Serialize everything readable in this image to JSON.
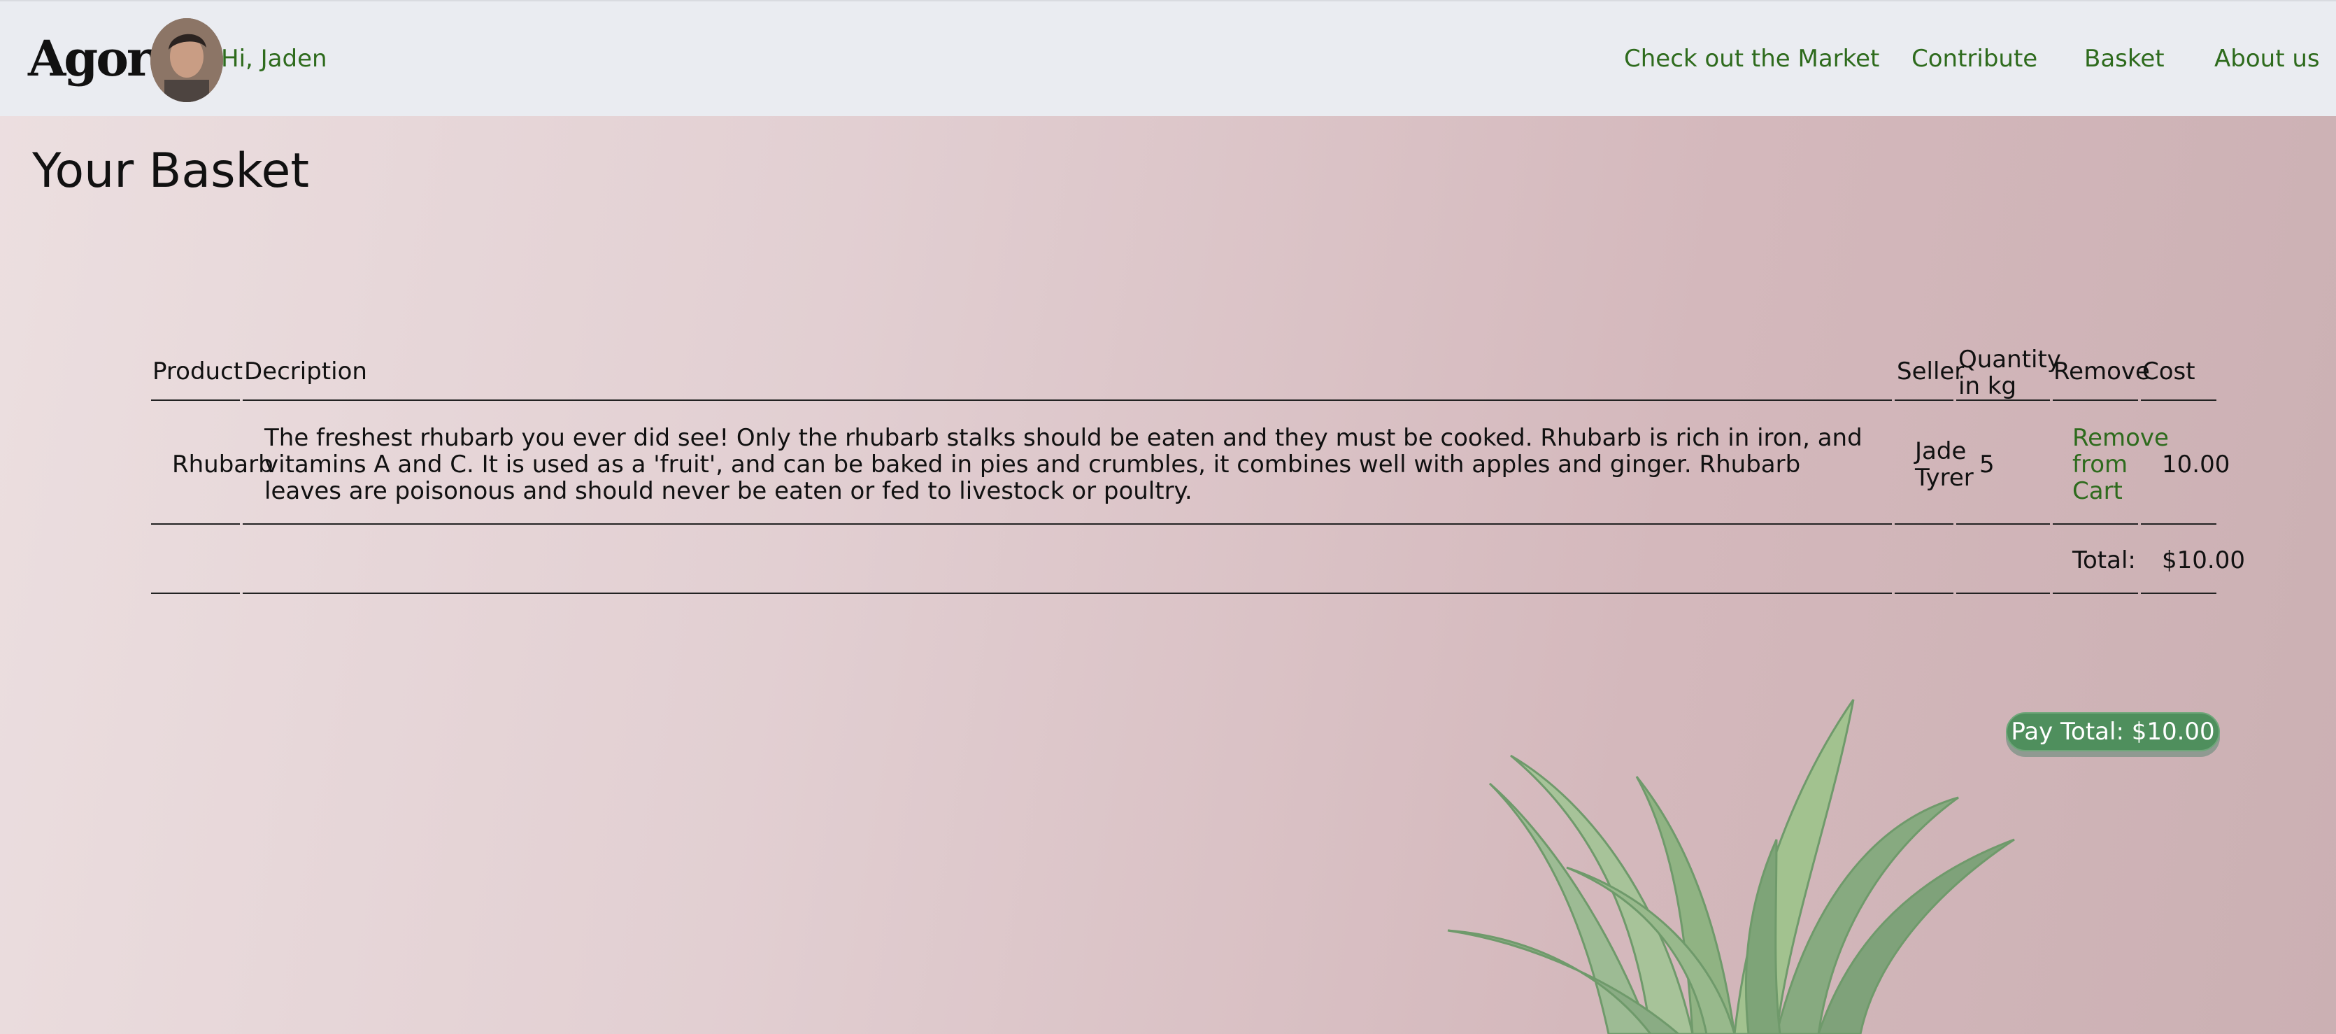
{
  "brand": "Agora",
  "greeting": "Hi, Jaden",
  "nav": {
    "market": "Check out the Market",
    "contribute": "Contribute",
    "basket": "Basket",
    "about": "About us"
  },
  "page_title": "Your Basket",
  "table": {
    "headers": {
      "product": "Product",
      "description": "Decription",
      "seller": "Seller",
      "quantity_line1": "Quantity",
      "quantity_line2": "in kg",
      "remove": "Remove",
      "cost": "Cost"
    },
    "rows": [
      {
        "product": "Rhubarb",
        "description": "The freshest rhubarb you ever did see! Only the rhubarb stalks should be eaten and they must be cooked. Rhubarb is rich in iron, and vitamins A and C. It is used as a 'fruit', and can be baked in pies and crumbles, it combines well with apples and ginger. Rhubarb leaves are poisonous and should never be eaten or fed to livestock or poultry.",
        "seller_line1": "Jade",
        "seller_line2": "Tyrer",
        "quantity": "5",
        "remove_line1": "Remove",
        "remove_line2": "from",
        "remove_line3": "Cart",
        "cost": "10.00"
      }
    ],
    "total_label": "Total:",
    "total_value": "$10.00"
  },
  "pay_button": "Pay Total: $10.00",
  "colors": {
    "link_green": "#2e6b1d",
    "button_green": "#4f8f5d",
    "navbar_bg": "#eaecf1"
  },
  "icons": {
    "avatar": "user-avatar-photo",
    "decor": "succulent-plant-image"
  }
}
